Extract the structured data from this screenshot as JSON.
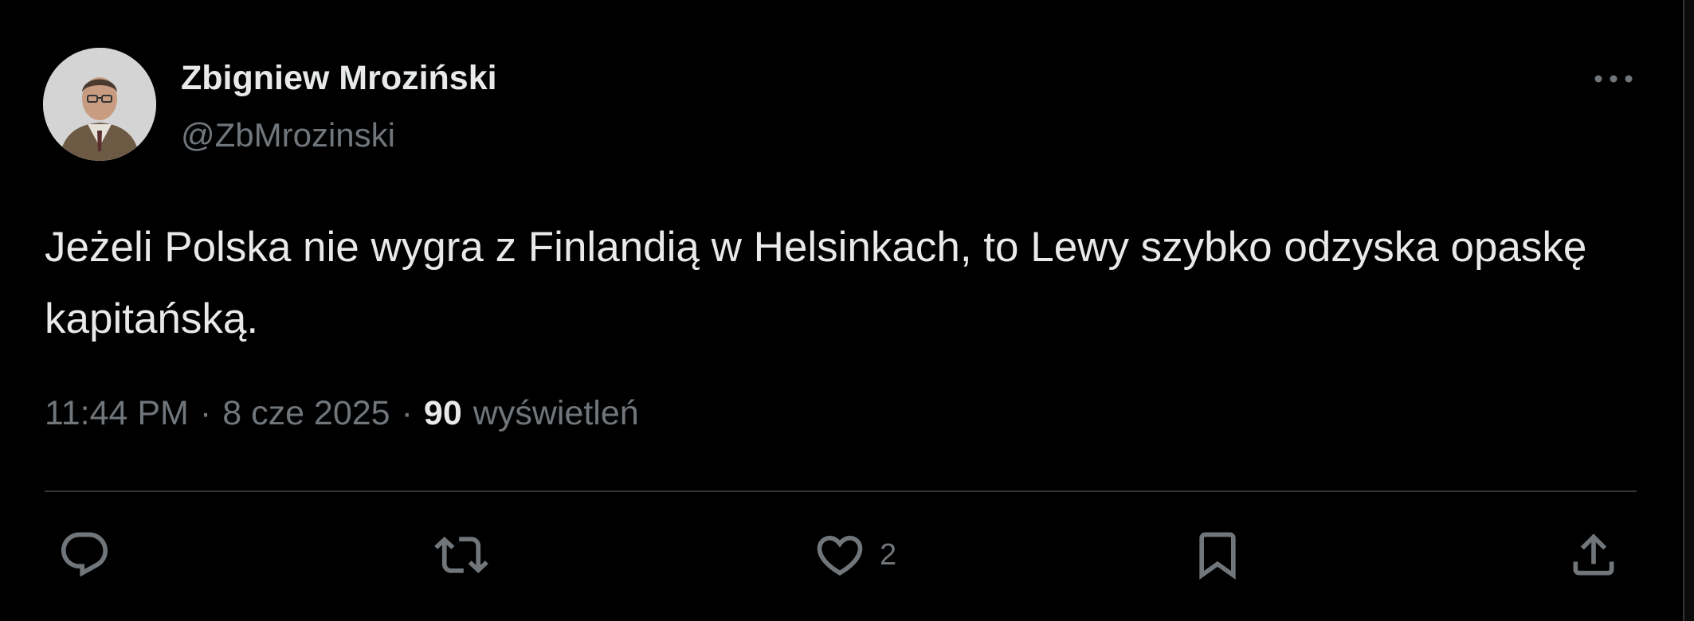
{
  "author": {
    "display_name": "Zbigniew Mroziński",
    "handle": "@ZbMrozinski"
  },
  "tweet": {
    "text": "Jeżeli Polska nie wygra z Finlandią w Helsinkach,  to Lewy szybko odzyska opaskę kapitańską.",
    "time": "11:44 PM",
    "date": "8 cze 2025",
    "separator": "·",
    "views_count": "90",
    "views_label": "wyświetleń"
  },
  "actions": {
    "reply_icon": "reply-icon",
    "retweet_icon": "retweet-icon",
    "like_icon": "heart-icon",
    "like_count": "2",
    "bookmark_icon": "bookmark-icon",
    "share_icon": "share-icon",
    "more_icon": "more-dots-icon"
  },
  "colors": {
    "background": "#000000",
    "primary_text": "#e7e9ea",
    "secondary_text": "#71767b",
    "divider": "#2f3336"
  }
}
